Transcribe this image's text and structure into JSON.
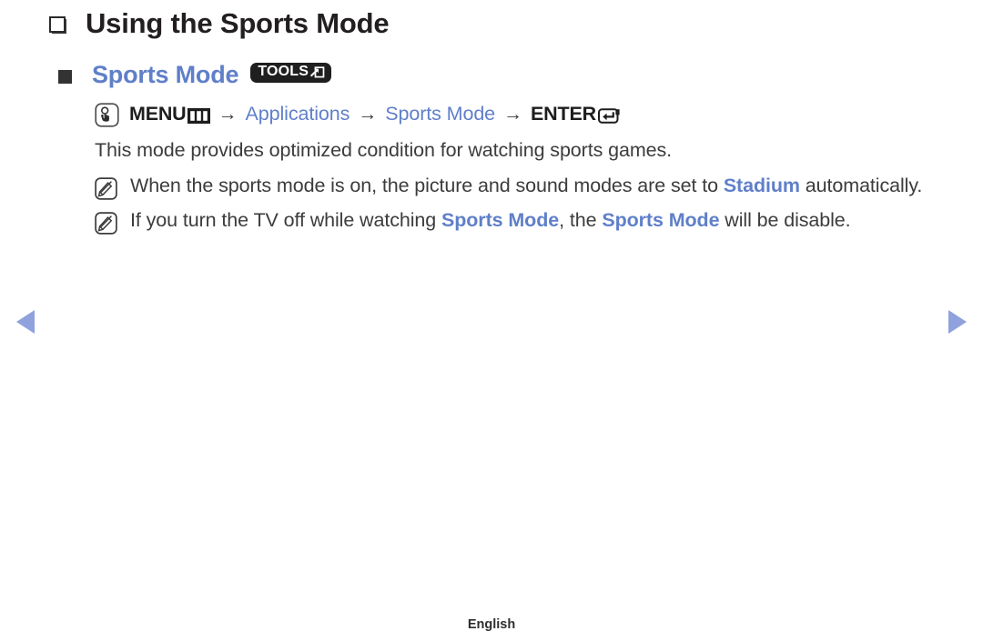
{
  "page": {
    "title": "Using the Sports Mode",
    "title_bullet_icon": "hollow-square-bullet-icon",
    "footer_language": "English"
  },
  "nav": {
    "prev_icon": "left-triangle-arrow-icon",
    "next_icon": "right-triangle-arrow-icon",
    "arrow_color": "#90a2dd"
  },
  "section": {
    "bullet_icon": "filled-square-bullet-icon",
    "heading": "Sports Mode",
    "heading_color": "#5f7fc9",
    "tools_badge": {
      "label": "TOOLS",
      "icon": "tools-arrow-into-box-icon",
      "background": "#1f1f1f",
      "text_color": "#ffffff"
    }
  },
  "menu_path": {
    "oo_icon": "hand-press-button-icon",
    "menu_label": "MENU",
    "menu_glyph_icon": "menu-three-bars-icon",
    "arrow": "→",
    "step_applications": "Applications",
    "step_sports_mode": "Sports Mode",
    "enter_label": "ENTER",
    "enter_glyph_icon": "enter-key-return-icon"
  },
  "description": "This mode provides optimized condition for watching sports games.",
  "notes": [
    {
      "icon": "note-pencil-icon",
      "parts": [
        {
          "text": "When the sports mode is on, the picture and sound modes are set to ",
          "style": "plain"
        },
        {
          "text": "Stadium",
          "style": "highlight"
        },
        {
          "text": " automatically.",
          "style": "plain"
        }
      ]
    },
    {
      "icon": "note-pencil-icon",
      "parts": [
        {
          "text": "If you turn the TV off while watching ",
          "style": "plain"
        },
        {
          "text": "Sports Mode",
          "style": "highlight"
        },
        {
          "text": ", the ",
          "style": "plain"
        },
        {
          "text": "Sports Mode",
          "style": "highlight"
        },
        {
          "text": " will be disable.",
          "style": "plain"
        }
      ]
    }
  ]
}
